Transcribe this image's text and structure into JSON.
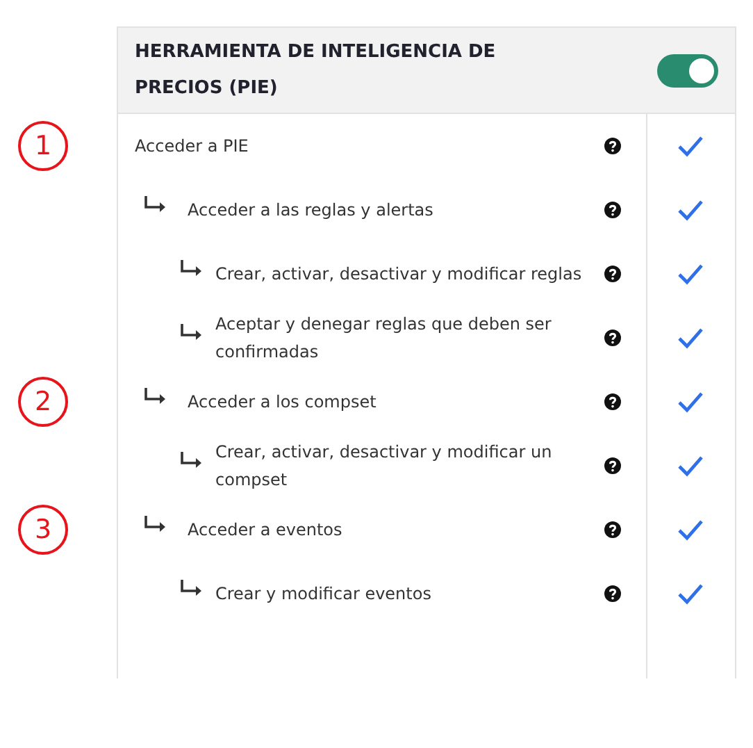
{
  "section": {
    "title": "HERRAMIENTA DE INTELIGENCIA DE PRECIOS (PIE)",
    "enabled": true
  },
  "permissions": [
    {
      "label": "Acceder a PIE",
      "annotation": "1",
      "granted": true,
      "children": [
        {
          "label": "Acceder a las reglas y alertas",
          "granted": true,
          "children": [
            {
              "label": "Crear, activar, desactivar y modificar reglas",
              "granted": true
            },
            {
              "label": "Aceptar y denegar reglas que deben ser confirmadas",
              "granted": true
            }
          ]
        },
        {
          "label": "Acceder a los compset",
          "annotation": "2",
          "granted": true,
          "children": [
            {
              "label": "Crear, activar, desactivar y modificar un compset",
              "granted": true
            }
          ]
        },
        {
          "label": "Acceder a eventos",
          "annotation": "3",
          "granted": true,
          "children": [
            {
              "label": "Crear y modificar eventos",
              "granted": true
            }
          ]
        }
      ]
    }
  ]
}
